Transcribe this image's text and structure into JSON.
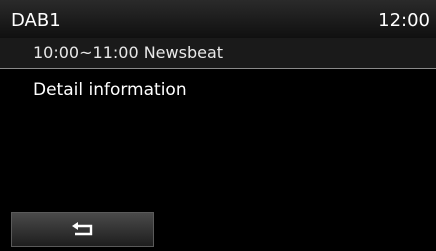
{
  "status_bar": {
    "source": "DAB1",
    "time": "12:00"
  },
  "program": {
    "title": "10:00~11:00 Newsbeat"
  },
  "detail": {
    "label": "Detail information"
  },
  "footer": {
    "back_icon": "return-arrow-icon"
  }
}
